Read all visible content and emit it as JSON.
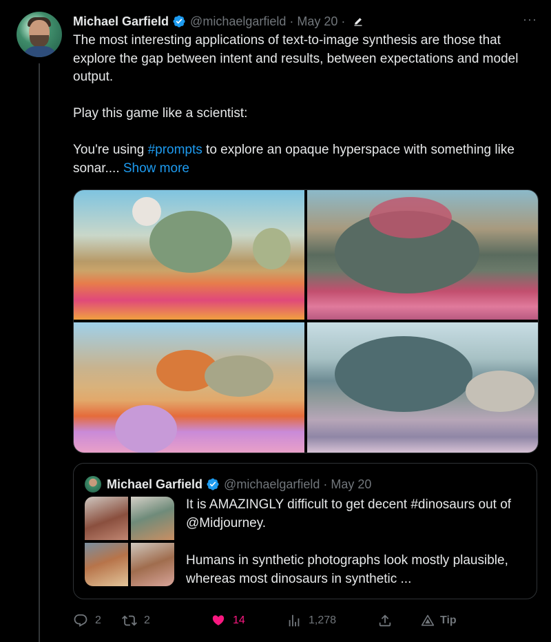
{
  "tweet": {
    "author_name": "Michael Garfield",
    "handle": "@michaelgarfield",
    "separator": "·",
    "date": "May 20",
    "separator2": "·",
    "more_label": "···",
    "text_line1": "The most interesting applications of text-to-image synthesis are those that explore the gap between intent and results, between expectations and model output.",
    "text_line2": "Play this game like a scientist:",
    "text_line3_before": "You're using ",
    "hashtag": "#prompts",
    "text_line3_after": " to explore an opaque hyperspace with something like sonar.... ",
    "show_more": "Show more"
  },
  "quote": {
    "author_name": "Michael Garfield",
    "handle": "@michaelgarfield",
    "separator": "·",
    "date": "May 20",
    "text_line1": "It is AMAZINGLY difficult to get decent  #dinosaurs out of @Midjourney.",
    "text_line2": "Humans in synthetic photographs look mostly plausible, whereas most dinosaurs in synthetic ..."
  },
  "actions": {
    "replies": "2",
    "retweets": "2",
    "likes": "14",
    "views": "1,278",
    "tip_label": "Tip"
  },
  "colors": {
    "background": "#000000",
    "text": "#e7e9ea",
    "secondary": "#71767b",
    "link": "#1d9bf0",
    "like": "#f91880",
    "verified": "#1d9bf0"
  },
  "icons": [
    "verified-badge-icon",
    "edit-pencil-icon",
    "more-icon",
    "reply-icon",
    "retweet-icon",
    "like-heart-icon",
    "views-bar-chart-icon",
    "share-icon",
    "tip-icon"
  ]
}
